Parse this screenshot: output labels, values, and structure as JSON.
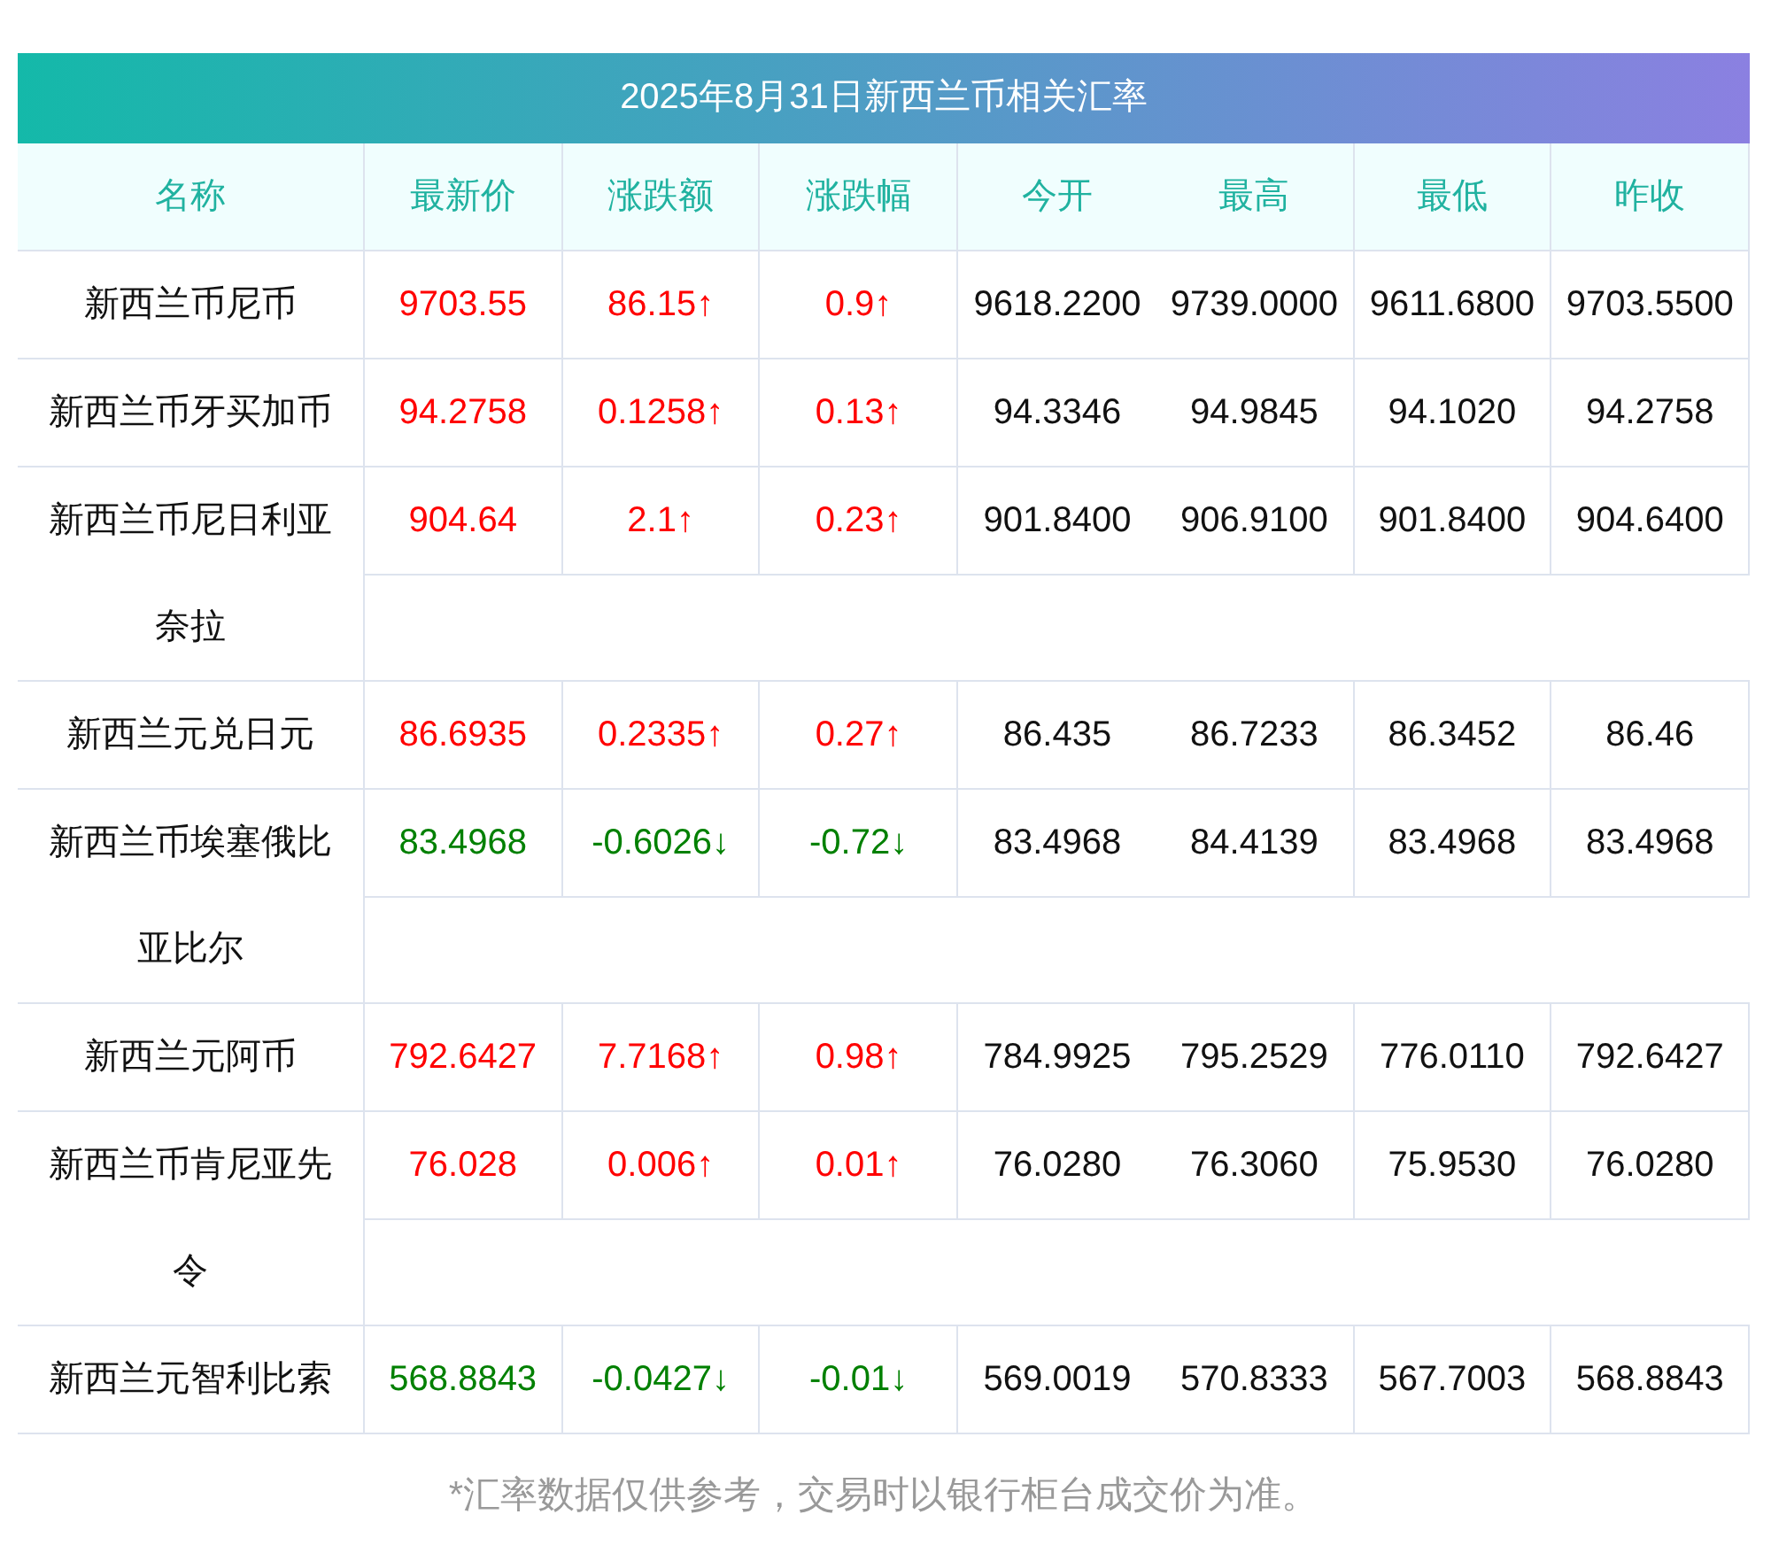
{
  "title": "2025年8月31日新西兰币相关汇率",
  "columns": [
    "名称",
    "最新价",
    "涨跌额",
    "涨跌幅",
    "今开",
    "最高",
    "最低",
    "昨收"
  ],
  "rows": [
    {
      "name": "新西兰币尼币",
      "color": "#ff0000",
      "latest": "9703.55",
      "change": "86.15↑",
      "change_pct": "0.9↑",
      "open": "9618.2200",
      "high": "9739.0000",
      "low": "9611.6800",
      "prev_close": "9703.5500"
    },
    {
      "name": "新西兰币牙买加币",
      "color": "#ff0000",
      "latest": "94.2758",
      "change": "0.1258↑",
      "change_pct": "0.13↑",
      "open": "94.3346",
      "high": "94.9845",
      "low": "94.1020",
      "prev_close": "94.2758"
    },
    {
      "name": "新西兰币尼日利亚奈拉",
      "color": "#ff0000",
      "latest": "904.64",
      "change": "2.1↑",
      "change_pct": "0.23↑",
      "open": "901.8400",
      "high": "906.9100",
      "low": "901.8400",
      "prev_close": "904.6400"
    },
    {
      "name": "新西兰元兑日元",
      "color": "#ff0000",
      "latest": "86.6935",
      "change": "0.2335↑",
      "change_pct": "0.27↑",
      "open": "86.435",
      "high": "86.7233",
      "low": "86.3452",
      "prev_close": "86.46"
    },
    {
      "name": "新西兰币埃塞俄比亚比尔",
      "color": "#008000",
      "latest": "83.4968",
      "change": "-0.6026↓",
      "change_pct": "-0.72↓",
      "open": "83.4968",
      "high": "84.4139",
      "low": "83.4968",
      "prev_close": "83.4968"
    },
    {
      "name": "新西兰元阿币",
      "color": "#ff0000",
      "latest": "792.6427",
      "change": "7.7168↑",
      "change_pct": "0.98↑",
      "open": "784.9925",
      "high": "795.2529",
      "low": "776.0110",
      "prev_close": "792.6427"
    },
    {
      "name": "新西兰币肯尼亚先令",
      "color": "#ff0000",
      "latest": "76.028",
      "change": "0.006↑",
      "change_pct": "0.01↑",
      "open": "76.0280",
      "high": "76.3060",
      "low": "75.9530",
      "prev_close": "76.0280"
    },
    {
      "name": "新西兰元智利比索",
      "color": "#008000",
      "latest": "568.8843",
      "change": "-0.0427↓",
      "change_pct": "-0.01↓",
      "open": "569.0019",
      "high": "570.8333",
      "low": "567.7003",
      "prev_close": "568.8843"
    }
  ],
  "footnote": "*汇率数据仅供参考，交易时以银行柜台成交价为准。"
}
